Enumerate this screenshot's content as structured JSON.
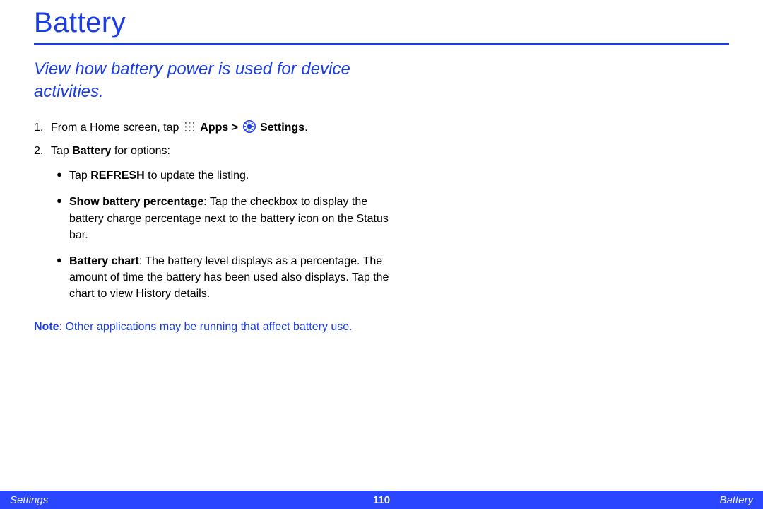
{
  "title": "Battery",
  "subtitle": "View how battery power is used for device activities.",
  "steps": {
    "s1": {
      "num": "1.",
      "pre": "From a Home screen, tap ",
      "apps": "Apps",
      "sep": " > ",
      "settings": "Settings",
      "post": "."
    },
    "s2": {
      "num": "2.",
      "pre": "Tap ",
      "bold": "Battery",
      "post": " for options:"
    }
  },
  "bullets": {
    "b1": {
      "pre": "Tap ",
      "bold": "REFRESH",
      "post": " to update the listing."
    },
    "b2": {
      "bold": "Show battery percentage",
      "post": ": Tap the checkbox to display the battery charge percentage next to the battery icon on the Status bar."
    },
    "b3": {
      "bold": "Battery chart",
      "post": ": The battery level displays as a percentage. The amount of time the battery has been used also displays. Tap the chart to view History details."
    }
  },
  "note": {
    "label": "Note",
    "text": ": Other applications may be running that affect battery use."
  },
  "footer": {
    "left": "Settings",
    "center": "110",
    "right": "Battery"
  }
}
